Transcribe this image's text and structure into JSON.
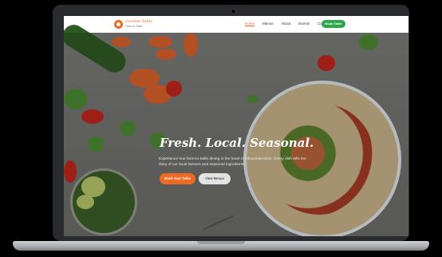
{
  "site": {
    "logo_title": "Garden Table",
    "logo_subtitle": "Farm to Table",
    "nav": [
      "Home",
      "Menus",
      "About",
      "Events",
      "Contact"
    ],
    "nav_active": "Home",
    "nav_cta": "Book Table"
  },
  "hero": {
    "title": "Fresh. Local. Seasonal.",
    "copy": "Experience true farm-to-table dining in the heart of Gloucestershire. Every dish tells the story of our local farmers and seasonal ingredients.",
    "primary_button": "Book Your Table",
    "secondary_button": "View Menus"
  },
  "colors": {
    "accent": "#ee6a23",
    "cta_green": "#2ea84a"
  }
}
